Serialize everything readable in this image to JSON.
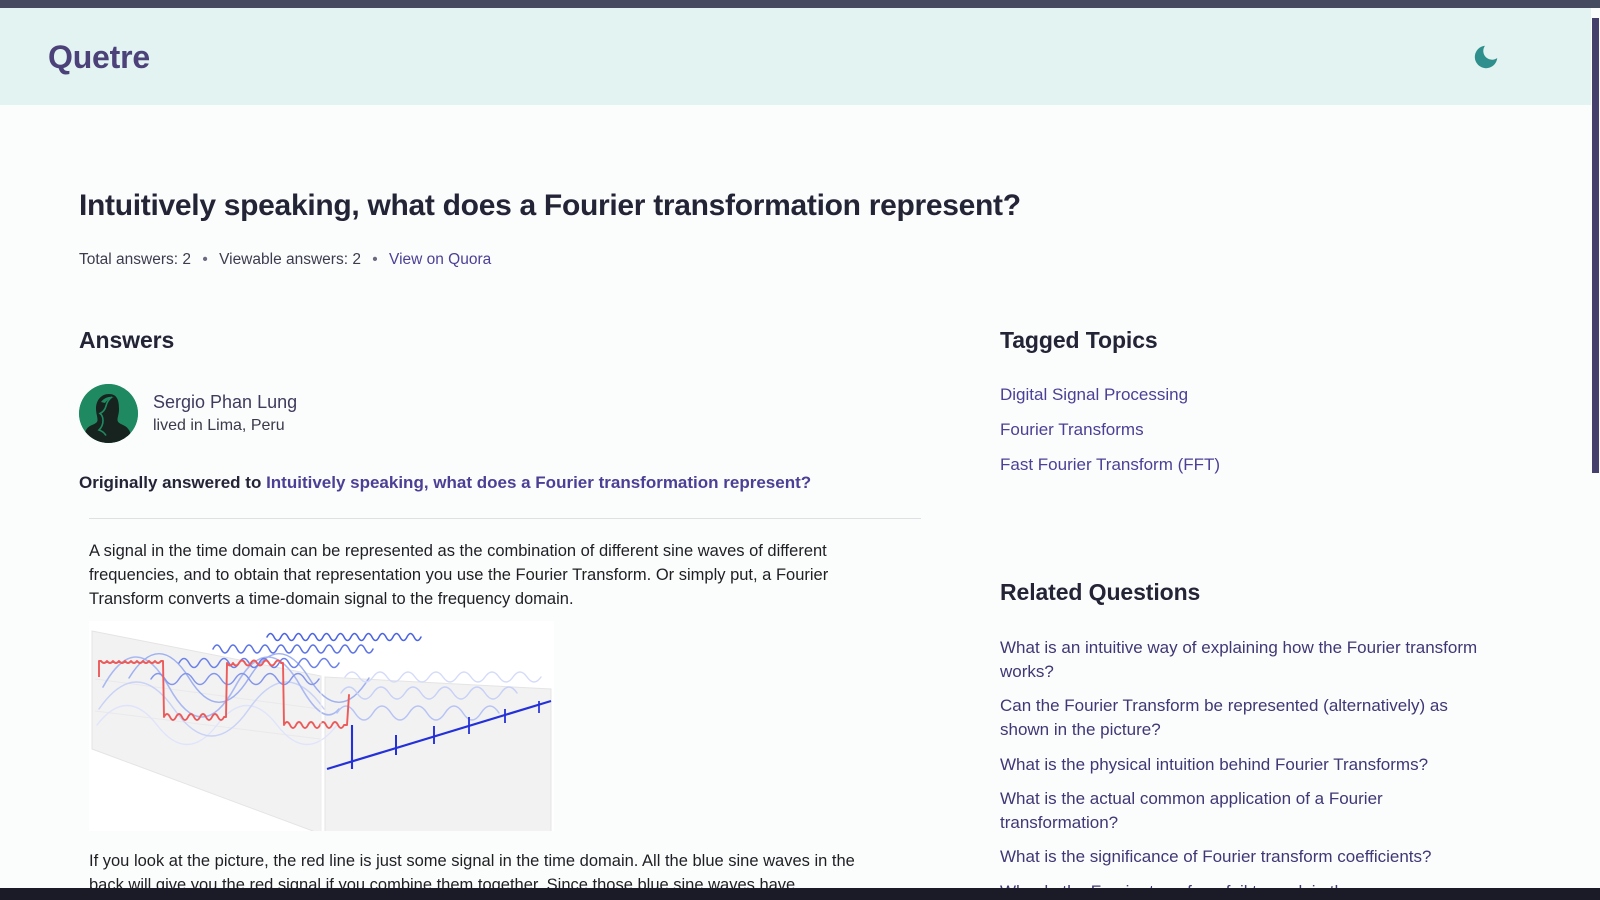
{
  "chrome": {
    "scrollbar": "vertical-scrollbar"
  },
  "header": {
    "brand": "Quetre",
    "theme_toggle_icon": "moon-icon",
    "bg_color": "#e2f3f2",
    "brand_color": "#4c4179",
    "accent_teal": "#2f8f8c"
  },
  "question": {
    "title": "Intuitively speaking, what does a Fourier transformation represent?",
    "meta": {
      "total_answers_label": "Total answers: 2",
      "separator": "•",
      "viewable_answers_label": "Viewable answers: 2",
      "quora_link_label": "View on Quora"
    }
  },
  "answers_section": {
    "heading": "Answers",
    "answer": {
      "author_name": "Sergio Phan Lung",
      "author_credential": "lived in Lima, Peru",
      "avatar_icon": "user-avatar",
      "avatar_bg": "#1f8a62",
      "originally_answered_prefix": "Originally answered to",
      "originally_answered_link": "Intuitively speaking, what does a Fourier transformation represent?",
      "paragraph_1": "A signal in the time domain can be represented as the combination of different sine waves of different frequencies, and to obtain that representation you use the Fourier Transform. Or simply put, a Fourier Transform converts a time-domain signal to the frequency domain.",
      "figure_alt": "fourier-transform-time-frequency-domain-diagram",
      "paragraph_2": "If you look at the picture, the red line is just some signal in the time domain. All the blue sine waves in the back will give you the red signal if you combine them together. Since those blue sine waves have"
    }
  },
  "sidebar": {
    "tagged_topics": {
      "heading": "Tagged Topics",
      "items": [
        "Digital Signal Processing",
        "Fourier Transforms",
        "Fast Fourier Transform (FFT)"
      ]
    },
    "related_questions": {
      "heading": "Related Questions",
      "items": [
        "What is an intuitive way of explaining how the Fourier transform works?",
        "Can the Fourier Transform be represented (alternatively) as shown in the picture?",
        "What is the physical intuition behind Fourier Transforms?",
        "What is the actual common application of a Fourier transformation?",
        "What is the significance of Fourier transform coefficients?",
        "Why do the Fourier transform fail to work in the"
      ]
    }
  },
  "colors": {
    "link_purple": "#4b3f96",
    "heading_navy": "#242437",
    "body_text": "#1f1f24",
    "signal_red": "#ec5a5a",
    "spectrum_blue": "#2430d8",
    "sine_blue": "#8f9ce8"
  }
}
